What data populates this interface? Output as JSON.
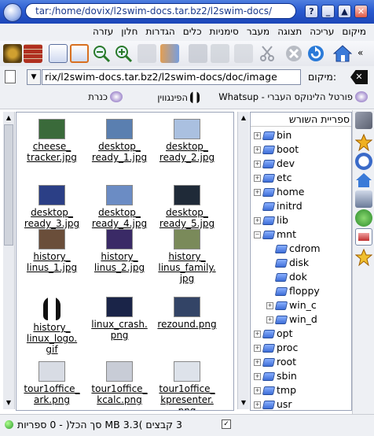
{
  "window": {
    "title": "tar:/home/dovix/l2swim-docs.tar.bz2/l2swim-docs/",
    "buttons": [
      "?",
      "_",
      "▲",
      "✕"
    ]
  },
  "menubar": {
    "items": [
      "מיקום",
      "עריכה",
      "תצוגה",
      "מעבר",
      "סימניות",
      "כלים",
      "הגדרות",
      "חלון",
      "עזרה"
    ]
  },
  "location": {
    "label": "מיקום:",
    "value": "rix/l2swim-docs.tar.bz2/l2swim-docs/doc/image"
  },
  "bookmarks": {
    "items": [
      {
        "label": "פורטל הלינוקס העברי - Whatsup",
        "icon": "konqueror-icon"
      },
      {
        "label": "הפינגווין",
        "icon": "tux-icon"
      },
      {
        "label": "כנרת",
        "icon": "konqueror-icon"
      }
    ]
  },
  "files": [
    {
      "name_lines": [
        "cheese_",
        "tracker.jpg"
      ],
      "thumb": "#3a6a3a"
    },
    {
      "name_lines": [
        "desktop_",
        "ready_1.jpg"
      ],
      "thumb": "#5a7fb0"
    },
    {
      "name_lines": [
        "desktop_",
        "ready_2.jpg"
      ],
      "thumb": "#aac0e0"
    },
    {
      "name_lines": [
        "desktop_",
        "ready_3.jpg"
      ],
      "thumb": "#2b3f86"
    },
    {
      "name_lines": [
        "desktop_",
        "ready_4.jpg"
      ],
      "thumb": "#6b8cc4"
    },
    {
      "name_lines": [
        "desktop_",
        "ready_5.jpg"
      ],
      "thumb": "#1f2a38"
    },
    {
      "name_lines": [
        "history_",
        "linus_1.jpg"
      ],
      "thumb": "#6a4e3a"
    },
    {
      "name_lines": [
        "history_",
        "linus_2.jpg"
      ],
      "thumb": "#3a2a66"
    },
    {
      "name_lines": [
        "history_",
        "linus_family.",
        "jpg"
      ],
      "thumb": "#7a8a5a"
    },
    {
      "name_lines": [
        "history_",
        "linux_logo.",
        "gif"
      ],
      "thumb": "tux"
    },
    {
      "name_lines": [
        "linux_crash.",
        "png"
      ],
      "thumb": "#1a2448"
    },
    {
      "name_lines": [
        "rezound.png"
      ],
      "thumb": "#334466"
    },
    {
      "name_lines": [
        "tour1office_",
        "ark.png"
      ],
      "thumb": "#d8dce4"
    },
    {
      "name_lines": [
        "tour1office_",
        "kcalc.png"
      ],
      "thumb": "#c8ccd6"
    },
    {
      "name_lines": [
        "tour1office_",
        "kpresenter.",
        "png"
      ],
      "thumb": "#dde2ea"
    }
  ],
  "tree": {
    "header": "ספריית השורש",
    "items": [
      {
        "label": "bin",
        "level": 0,
        "expander": "+"
      },
      {
        "label": "boot",
        "level": 0,
        "expander": "+"
      },
      {
        "label": "dev",
        "level": 0,
        "expander": "+"
      },
      {
        "label": "etc",
        "level": 0,
        "expander": "+"
      },
      {
        "label": "home",
        "level": 0,
        "expander": "+"
      },
      {
        "label": "initrd",
        "level": 0,
        "expander": ""
      },
      {
        "label": "lib",
        "level": 0,
        "expander": "+"
      },
      {
        "label": "mnt",
        "level": 0,
        "expander": "−"
      },
      {
        "label": "cdrom",
        "level": 1,
        "expander": ""
      },
      {
        "label": "disk",
        "level": 1,
        "expander": ""
      },
      {
        "label": "dok",
        "level": 1,
        "expander": ""
      },
      {
        "label": "floppy",
        "level": 1,
        "expander": ""
      },
      {
        "label": "win_c",
        "level": 1,
        "expander": "+"
      },
      {
        "label": "win_d",
        "level": 1,
        "expander": "+"
      },
      {
        "label": "opt",
        "level": 0,
        "expander": "+"
      },
      {
        "label": "proc",
        "level": 0,
        "expander": "+"
      },
      {
        "label": "root",
        "level": 0,
        "expander": "+"
      },
      {
        "label": "sbin",
        "level": 0,
        "expander": "+"
      },
      {
        "label": "tmp",
        "level": 0,
        "expander": "+"
      },
      {
        "label": "usr",
        "level": 0,
        "expander": "+"
      }
    ]
  },
  "status": {
    "text": "3 קבצים )3.3 MB סך הכל( - 0 ספריות"
  },
  "colors": {
    "titlebar": "#2a5bd0",
    "accent": "#1c46b8"
  }
}
